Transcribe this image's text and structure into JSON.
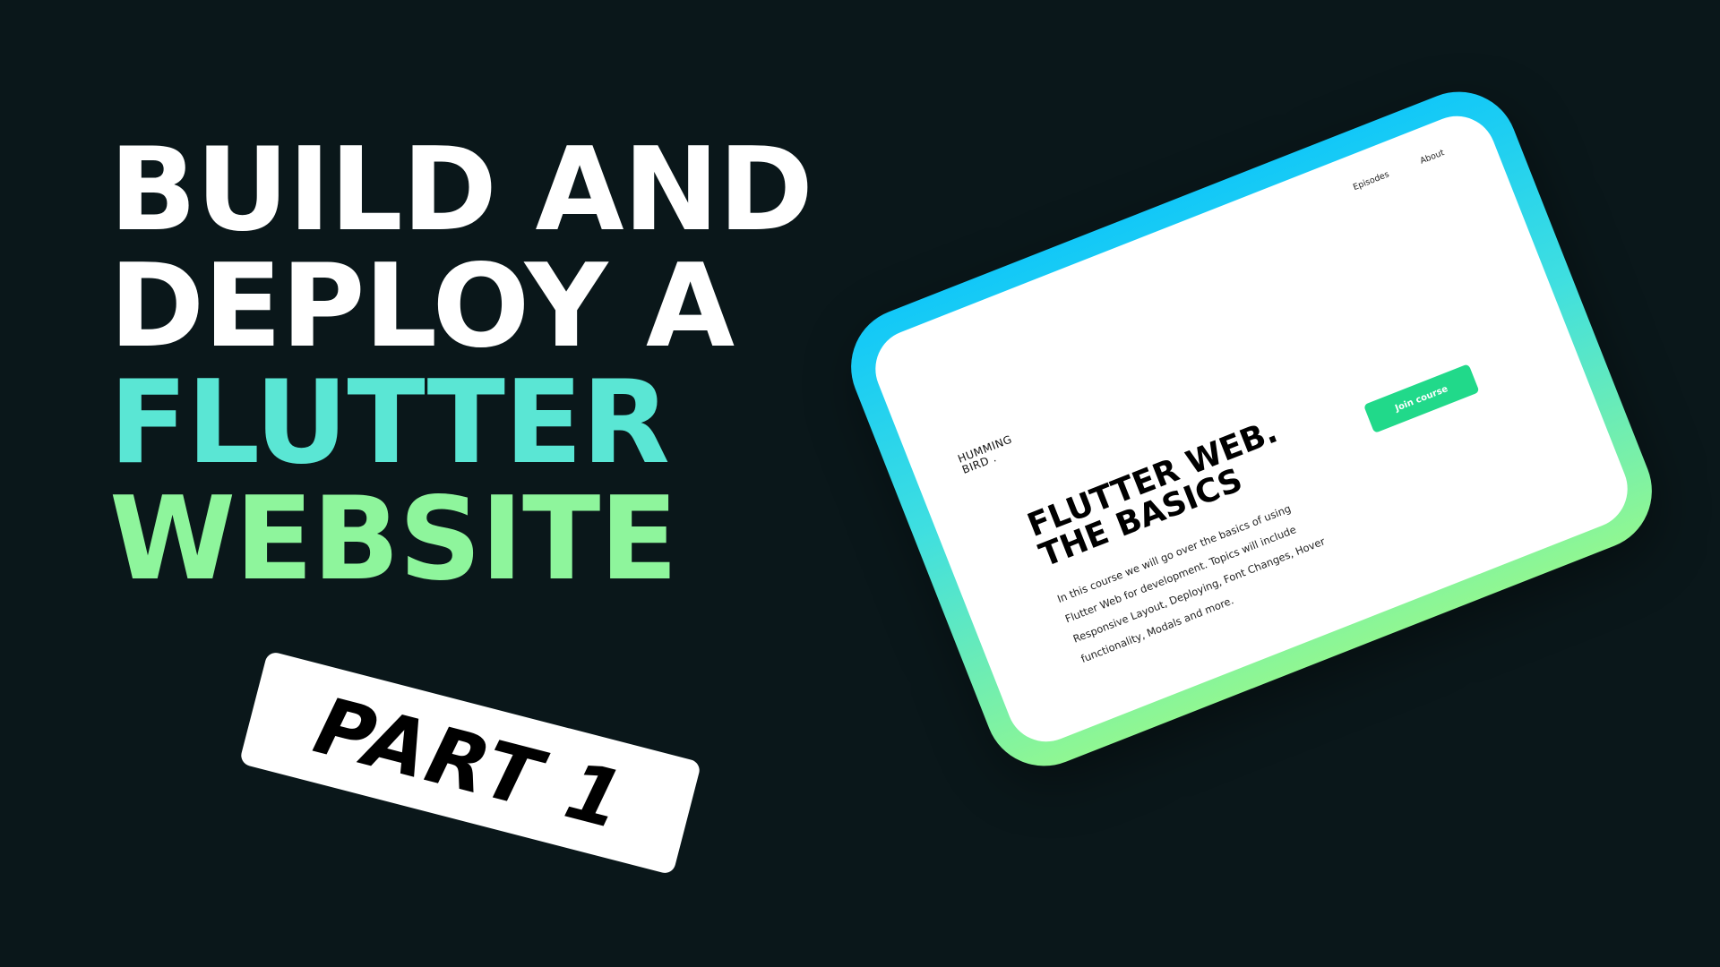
{
  "headline": {
    "line1": "BUILD AND",
    "line2": "DEPLOY A",
    "line3": "FLUTTER",
    "line4": "WEBSITE"
  },
  "part_tag": {
    "label": "PART 1"
  },
  "tablet": {
    "logo": {
      "line1": "HUMMING",
      "line2": "BIRD ."
    },
    "nav": {
      "episodes": "Episodes",
      "about": "About"
    },
    "hero": {
      "title_line1": "FLUTTER WEB.",
      "title_line2": "THE BASICS",
      "body": "In this course we will go over the basics of using Flutter Web for development. Topics will include Responsive Layout, Deploying, Font Changes, Hover functionality, Modals and more."
    },
    "join_button": "Join course"
  },
  "colors": {
    "background": "#0a171a",
    "headline_white": "#ffffff",
    "headline_teal": "#5ae6d4",
    "headline_green": "#8ef59c",
    "frame_gradient_top": "#12c8f8",
    "frame_gradient_bottom": "#90f792",
    "join_button": "#21d98a"
  }
}
